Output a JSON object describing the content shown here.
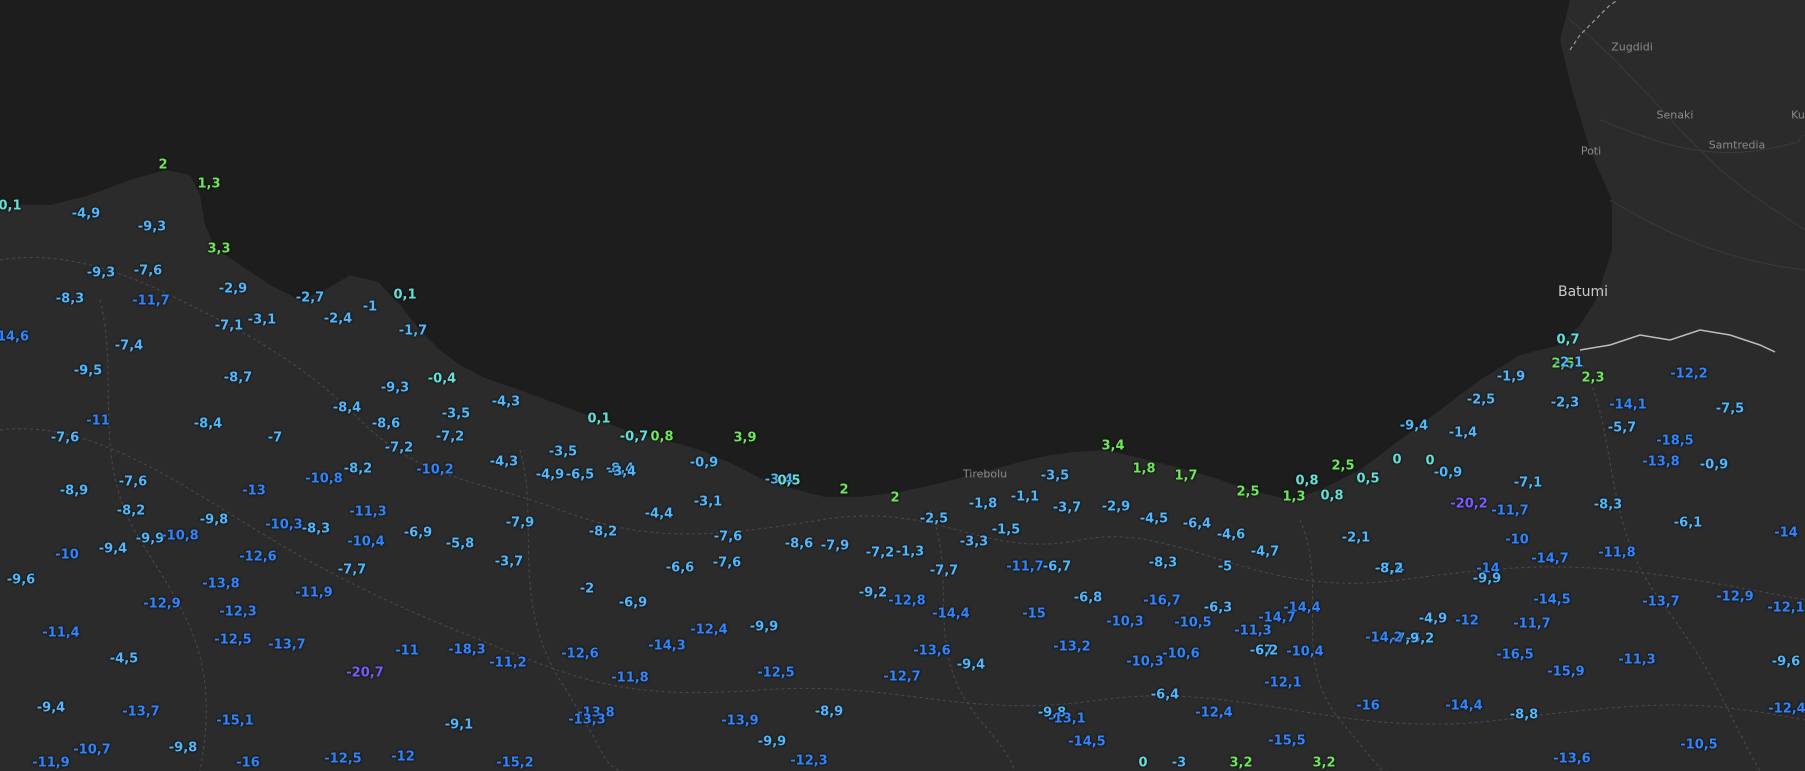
{
  "map": {
    "background": "#2a2a2a",
    "sea_color": "#1d1d1d",
    "border_color": "#bdbdbd",
    "colors": {
      "warm": "#6ee85a",
      "mild": "#63e0d8",
      "cool": "#4fb8ff",
      "cold": "#2f85ff",
      "frigid": "#7a5bff"
    }
  },
  "places": [
    {
      "name": "Zugdidi"
    },
    {
      "name": "Senaki"
    },
    {
      "name": "Poti"
    },
    {
      "name": "Samtredia"
    },
    {
      "name": "Ku"
    },
    {
      "name": "Batumi"
    },
    {
      "name": "Tirebolu"
    }
  ],
  "readings": [
    {
      "v": "2",
      "lvl": "warm"
    },
    {
      "v": "1,3",
      "lvl": "warm"
    },
    {
      "v": "0,1",
      "lvl": "mild"
    },
    {
      "v": "-4,9",
      "lvl": "cool"
    },
    {
      "v": "-9,3",
      "lvl": "cool"
    },
    {
      "v": "3,3",
      "lvl": "warm"
    },
    {
      "v": "-9,3",
      "lvl": "cool"
    },
    {
      "v": "-7,6",
      "lvl": "cool"
    },
    {
      "v": "-2,9",
      "lvl": "cool"
    },
    {
      "v": "-2,7",
      "lvl": "cool"
    },
    {
      "v": "0,1",
      "lvl": "mild"
    },
    {
      "v": "-8,3",
      "lvl": "cool"
    },
    {
      "v": "-11,7",
      "lvl": "cold"
    },
    {
      "v": "-1",
      "lvl": "cool"
    },
    {
      "v": "-2,4",
      "lvl": "cool"
    },
    {
      "v": "-7,1",
      "lvl": "cool"
    },
    {
      "v": "-3,1",
      "lvl": "cool"
    },
    {
      "v": "-1,7",
      "lvl": "cool"
    },
    {
      "v": "14,6",
      "lvl": "cold"
    },
    {
      "v": "-7,4",
      "lvl": "cool"
    },
    {
      "v": "-9,5",
      "lvl": "cool"
    },
    {
      "v": "-8,7",
      "lvl": "cool"
    },
    {
      "v": "-0,4",
      "lvl": "mild"
    },
    {
      "v": "-9,3",
      "lvl": "cool"
    },
    {
      "v": "-4,3",
      "lvl": "cool"
    },
    {
      "v": "-8,4",
      "lvl": "cool"
    },
    {
      "v": "-3,5",
      "lvl": "cool"
    },
    {
      "v": "-11",
      "lvl": "cold"
    },
    {
      "v": "-8,6",
      "lvl": "cool"
    },
    {
      "v": "0,1",
      "lvl": "mild"
    },
    {
      "v": "-7,6",
      "lvl": "cool"
    },
    {
      "v": "-8,4",
      "lvl": "cool"
    },
    {
      "v": "-7",
      "lvl": "cool"
    },
    {
      "v": "-7,2",
      "lvl": "cool"
    },
    {
      "v": "-0,7",
      "lvl": "mild"
    },
    {
      "v": "0,8",
      "lvl": "warm"
    },
    {
      "v": "3,9",
      "lvl": "warm"
    },
    {
      "v": "-7,2",
      "lvl": "cool"
    },
    {
      "v": "-3,5",
      "lvl": "cool"
    },
    {
      "v": "-8,4",
      "lvl": "cool"
    },
    {
      "v": "-4,3",
      "lvl": "cool"
    },
    {
      "v": "-3,4",
      "lvl": "cool"
    },
    {
      "v": "-0,9",
      "lvl": "cool"
    },
    {
      "v": "-10,8",
      "lvl": "cold"
    },
    {
      "v": "-8,2",
      "lvl": "cool"
    },
    {
      "v": "-10,2",
      "lvl": "cold"
    },
    {
      "v": "-4,9",
      "lvl": "cool"
    },
    {
      "v": "-6,5",
      "lvl": "cool"
    },
    {
      "v": "-7,6",
      "lvl": "cool"
    },
    {
      "v": "-3,4",
      "lvl": "cool"
    },
    {
      "v": "0,5",
      "lvl": "mild"
    },
    {
      "v": "-8,9",
      "lvl": "cool"
    },
    {
      "v": "-13",
      "lvl": "cold"
    },
    {
      "v": "-8,2",
      "lvl": "cool"
    },
    {
      "v": "-11,3",
      "lvl": "cold"
    },
    {
      "v": "-3,1",
      "lvl": "cool"
    },
    {
      "v": "2",
      "lvl": "warm"
    },
    {
      "v": "2",
      "lvl": "warm"
    },
    {
      "v": "-9,8",
      "lvl": "cool"
    },
    {
      "v": "-10,3",
      "lvl": "cold"
    },
    {
      "v": "-8,3",
      "lvl": "cool"
    },
    {
      "v": "-7,9",
      "lvl": "cool"
    },
    {
      "v": "-4,4",
      "lvl": "cool"
    },
    {
      "v": "-2,5",
      "lvl": "cool"
    },
    {
      "v": "-1,8",
      "lvl": "cool"
    },
    {
      "v": "-1,1",
      "lvl": "cool"
    },
    {
      "v": "-3,5",
      "lvl": "cool"
    },
    {
      "v": "3,4",
      "lvl": "warm"
    },
    {
      "v": "1,8",
      "lvl": "warm"
    },
    {
      "v": "1,7",
      "lvl": "warm"
    },
    {
      "v": "-9,4",
      "lvl": "cool"
    },
    {
      "v": "-9,9",
      "lvl": "cool"
    },
    {
      "v": "-10,8",
      "lvl": "cold"
    },
    {
      "v": "-10,4",
      "lvl": "cold"
    },
    {
      "v": "-6,9",
      "lvl": "cool"
    },
    {
      "v": "-5,8",
      "lvl": "cool"
    },
    {
      "v": "-8,2",
      "lvl": "cool"
    },
    {
      "v": "-7,6",
      "lvl": "cool"
    },
    {
      "v": "-8,6",
      "lvl": "cool"
    },
    {
      "v": "-7,9",
      "lvl": "cool"
    },
    {
      "v": "-7,2",
      "lvl": "cool"
    },
    {
      "v": "-1,3",
      "lvl": "cool"
    },
    {
      "v": "-3,3",
      "lvl": "cool"
    },
    {
      "v": "-1,5",
      "lvl": "cool"
    },
    {
      "v": "-3,7",
      "lvl": "cool"
    },
    {
      "v": "-2,9",
      "lvl": "cool"
    },
    {
      "v": "-4,5",
      "lvl": "cool"
    },
    {
      "v": "-6,4",
      "lvl": "cool"
    },
    {
      "v": "-4,6",
      "lvl": "cool"
    },
    {
      "v": "2,5",
      "lvl": "warm"
    },
    {
      "v": "1,3",
      "lvl": "warm"
    },
    {
      "v": "0,8",
      "lvl": "mild"
    },
    {
      "v": "2,5",
      "lvl": "warm"
    },
    {
      "v": "0,8",
      "lvl": "mild"
    },
    {
      "v": "0,5",
      "lvl": "mild"
    },
    {
      "v": "0",
      "lvl": "mild"
    },
    {
      "v": "0",
      "lvl": "mild"
    },
    {
      "v": "-0,9",
      "lvl": "cool"
    },
    {
      "v": "-10",
      "lvl": "cold"
    },
    {
      "v": "-12,6",
      "lvl": "cold"
    },
    {
      "v": "-7,7",
      "lvl": "cool"
    },
    {
      "v": "-3,7",
      "lvl": "cool"
    },
    {
      "v": "-6,6",
      "lvl": "cool"
    },
    {
      "v": "-7,6",
      "lvl": "cool"
    },
    {
      "v": "-7,7",
      "lvl": "cool"
    },
    {
      "v": "-11,7",
      "lvl": "cold"
    },
    {
      "v": "-6,7",
      "lvl": "cool"
    },
    {
      "v": "-8,3",
      "lvl": "cool"
    },
    {
      "v": "-5",
      "lvl": "cool"
    },
    {
      "v": "-4,7",
      "lvl": "cool"
    },
    {
      "v": "-2,1",
      "lvl": "cool"
    },
    {
      "v": "-9,6",
      "lvl": "cool"
    },
    {
      "v": "-13,8",
      "lvl": "cold"
    },
    {
      "v": "-11,9",
      "lvl": "cold"
    },
    {
      "v": "-2",
      "lvl": "cool"
    },
    {
      "v": "-6,9",
      "lvl": "cool"
    },
    {
      "v": "-9,2",
      "lvl": "cool"
    },
    {
      "v": "-12,8",
      "lvl": "cold"
    },
    {
      "v": "-14,4",
      "lvl": "cold"
    },
    {
      "v": "-15",
      "lvl": "cold"
    },
    {
      "v": "-6,8",
      "lvl": "cool"
    },
    {
      "v": "-16,7",
      "lvl": "cold"
    },
    {
      "v": "-6,3",
      "lvl": "cool"
    },
    {
      "v": "-14,4",
      "lvl": "cold"
    },
    {
      "v": "-14,7",
      "lvl": "cold"
    },
    {
      "v": "-7,4",
      "lvl": "cool"
    },
    {
      "v": "-14",
      "lvl": "cold"
    },
    {
      "v": "-12,9",
      "lvl": "cold"
    },
    {
      "v": "-12,3",
      "lvl": "cold"
    },
    {
      "v": "-11,4",
      "lvl": "cold"
    },
    {
      "v": "-12,5",
      "lvl": "cold"
    },
    {
      "v": "-13,7",
      "lvl": "cold"
    },
    {
      "v": "-12,4",
      "lvl": "cold"
    },
    {
      "v": "-9,9",
      "lvl": "cool"
    },
    {
      "v": "-10,3",
      "lvl": "cold"
    },
    {
      "v": "-13,2",
      "lvl": "cold"
    },
    {
      "v": "-10,5",
      "lvl": "cold"
    },
    {
      "v": "-11,3",
      "lvl": "cold"
    },
    {
      "v": "-7",
      "lvl": "cool"
    },
    {
      "v": "-6,2",
      "lvl": "cool"
    },
    {
      "v": "-4,9",
      "lvl": "cool"
    },
    {
      "v": "-7,9",
      "lvl": "cool"
    },
    {
      "v": "-4,5",
      "lvl": "cool"
    },
    {
      "v": "-11",
      "lvl": "cold"
    },
    {
      "v": "-18,3",
      "lvl": "cold"
    },
    {
      "v": "-11,2",
      "lvl": "cold"
    },
    {
      "v": "-12,6",
      "lvl": "cold"
    },
    {
      "v": "-14,3",
      "lvl": "cold"
    },
    {
      "v": "-13,6",
      "lvl": "cold"
    },
    {
      "v": "-9,4",
      "lvl": "cool"
    },
    {
      "v": "-10,3",
      "lvl": "cold"
    },
    {
      "v": "-10,6",
      "lvl": "cold"
    },
    {
      "v": "-6,2",
      "lvl": "cool"
    },
    {
      "v": "-10,4",
      "lvl": "cold"
    },
    {
      "v": "-14,2",
      "lvl": "cold"
    },
    {
      "v": "-20,7",
      "lvl": "frigid"
    },
    {
      "v": "-11,8",
      "lvl": "cold"
    },
    {
      "v": "-12,5",
      "lvl": "cold"
    },
    {
      "v": "-12,7",
      "lvl": "cold"
    },
    {
      "v": "-9,4",
      "lvl": "cool"
    },
    {
      "v": "-13,7",
      "lvl": "cold"
    },
    {
      "v": "-15,1",
      "lvl": "cold"
    },
    {
      "v": "-13,8",
      "lvl": "cold"
    },
    {
      "v": "-13,3",
      "lvl": "cold"
    },
    {
      "v": "-8,9",
      "lvl": "cool"
    },
    {
      "v": "-9,8",
      "lvl": "cool"
    },
    {
      "v": "-6,4",
      "lvl": "cool"
    },
    {
      "v": "-12,4",
      "lvl": "cold"
    },
    {
      "v": "-12,1",
      "lvl": "cold"
    },
    {
      "v": "-9,1",
      "lvl": "cool"
    },
    {
      "v": "-13,1",
      "lvl": "cold"
    },
    {
      "v": "-13,9",
      "lvl": "cold"
    },
    {
      "v": "-16",
      "lvl": "cold"
    },
    {
      "v": "-10,7",
      "lvl": "cold"
    },
    {
      "v": "-9,8",
      "lvl": "cool"
    },
    {
      "v": "-9,9",
      "lvl": "cool"
    },
    {
      "v": "-14,5",
      "lvl": "cold"
    },
    {
      "v": "-15,5",
      "lvl": "cold"
    },
    {
      "v": "-12,5",
      "lvl": "cold"
    },
    {
      "v": "-12",
      "lvl": "cold"
    },
    {
      "v": "-12,3",
      "lvl": "cold"
    },
    {
      "v": "-16",
      "lvl": "cold"
    },
    {
      "v": "-11,9",
      "lvl": "cold"
    },
    {
      "v": "-15,2",
      "lvl": "cold"
    },
    {
      "v": "0",
      "lvl": "mild"
    },
    {
      "v": "-3",
      "lvl": "cool"
    },
    {
      "v": "3,2",
      "lvl": "warm"
    },
    {
      "v": "3,2",
      "lvl": "warm"
    },
    {
      "v": "0,7",
      "lvl": "mild"
    },
    {
      "v": "2,5",
      "lvl": "warm"
    },
    {
      "v": "-2,1",
      "lvl": "cool"
    },
    {
      "v": "-1,9",
      "lvl": "cool"
    },
    {
      "v": "2,3",
      "lvl": "warm"
    },
    {
      "v": "-2,5",
      "lvl": "cool"
    },
    {
      "v": "-2,3",
      "lvl": "cool"
    },
    {
      "v": "-14,1",
      "lvl": "cold"
    },
    {
      "v": "-9,4",
      "lvl": "cool"
    },
    {
      "v": "-1,4",
      "lvl": "cool"
    },
    {
      "v": "-5,7",
      "lvl": "cool"
    },
    {
      "v": "-12,2",
      "lvl": "cold"
    },
    {
      "v": "-7,5",
      "lvl": "cool"
    },
    {
      "v": "-18,5",
      "lvl": "cold"
    },
    {
      "v": "-13,8",
      "lvl": "cold"
    },
    {
      "v": "-0,9",
      "lvl": "cool"
    },
    {
      "v": "-7,1",
      "lvl": "cool"
    },
    {
      "v": "-20,2",
      "lvl": "frigid"
    },
    {
      "v": "-11,7",
      "lvl": "cold"
    },
    {
      "v": "-8,3",
      "lvl": "cool"
    },
    {
      "v": "-6,1",
      "lvl": "cool"
    },
    {
      "v": "-14",
      "lvl": "cold"
    },
    {
      "v": "-10",
      "lvl": "cold"
    },
    {
      "v": "-14,7",
      "lvl": "cold"
    },
    {
      "v": "-11,8",
      "lvl": "cold"
    },
    {
      "v": "-8,2",
      "lvl": "cool"
    },
    {
      "v": "-9,9",
      "lvl": "cool"
    },
    {
      "v": "-14,5",
      "lvl": "cold"
    },
    {
      "v": "-12",
      "lvl": "cold"
    },
    {
      "v": "-11,7",
      "lvl": "cold"
    },
    {
      "v": "-13,7",
      "lvl": "cold"
    },
    {
      "v": "-12,9",
      "lvl": "cold"
    },
    {
      "v": "-12,1",
      "lvl": "cold"
    },
    {
      "v": "-16,5",
      "lvl": "cold"
    },
    {
      "v": "-15,9",
      "lvl": "cold"
    },
    {
      "v": "-11,3",
      "lvl": "cold"
    },
    {
      "v": "-9,6",
      "lvl": "cool"
    },
    {
      "v": "-14,4",
      "lvl": "cold"
    },
    {
      "v": "-8,8",
      "lvl": "cool"
    },
    {
      "v": "-12,4",
      "lvl": "cold"
    },
    {
      "v": "-10,5",
      "lvl": "cold"
    },
    {
      "v": "-13,6",
      "lvl": "cold"
    }
  ]
}
